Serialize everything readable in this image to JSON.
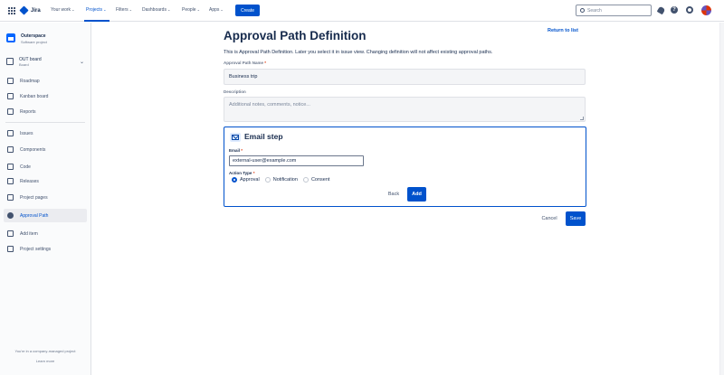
{
  "topnav": {
    "logo": "Jira",
    "items": [
      {
        "label": "Your work",
        "chevron": "⌄"
      },
      {
        "label": "Projects",
        "chevron": "⌄"
      },
      {
        "label": "Filters",
        "chevron": "⌄"
      },
      {
        "label": "Dashboards",
        "chevron": "⌄"
      },
      {
        "label": "People",
        "chevron": "⌄"
      },
      {
        "label": "Apps",
        "chevron": "⌄"
      }
    ],
    "active_item": "Projects",
    "create_label": "Create",
    "search_placeholder": "Search"
  },
  "sidebar": {
    "project_name": "Outerspace",
    "project_type": "Software project",
    "board_name": "OUT board",
    "board_sub": "Board",
    "items": [
      {
        "label": "Roadmap",
        "icon": "roadmap-icon"
      },
      {
        "label": "Kanban board",
        "icon": "kanban-icon"
      },
      {
        "label": "Reports",
        "icon": "reports-icon"
      },
      {
        "label": "Issues",
        "icon": "issues-icon"
      },
      {
        "label": "Components",
        "icon": "components-icon"
      },
      {
        "label": "Code",
        "icon": "code-icon"
      },
      {
        "label": "Releases",
        "icon": "releases-icon"
      },
      {
        "label": "Project pages",
        "icon": "pages-icon"
      },
      {
        "label": "Approval Path",
        "icon": "approval-icon"
      },
      {
        "label": "Add item",
        "icon": "add-icon"
      },
      {
        "label": "Project settings",
        "icon": "settings-icon"
      }
    ],
    "footer_text": "You're in a company-managed project",
    "footer_link": "Learn more"
  },
  "main": {
    "title": "Approval Path Definition",
    "return_link": "Return to list",
    "description": "This is Approval Path Definition. Later you select it in issue view. Changing definition will not affect existing approval paths.",
    "name_label": "Approval Path Name",
    "name_value": "Business trip",
    "desc_label": "Description",
    "desc_placeholder": "Additional notes, comments, notice...",
    "step": {
      "title": "Email step",
      "email_label": "Email",
      "email_value": "external-user@example.com",
      "action_label": "Action Type",
      "actions": [
        "Approval",
        "Notification",
        "Consent"
      ],
      "selected_action": "Approval",
      "back_label": "Back",
      "add_label": "Add"
    },
    "cancel_label": "Cancel",
    "save_label": "Save"
  }
}
